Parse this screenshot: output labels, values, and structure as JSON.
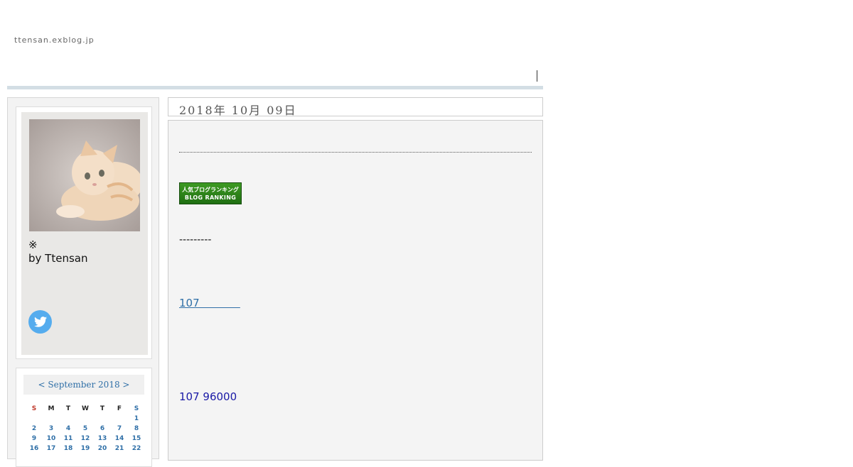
{
  "header": {
    "site_url": "ttensan.exblog.jp"
  },
  "profile": {
    "mark": "※",
    "author": "by Ttensan",
    "photo_icon": "kitten-photo",
    "twitter_icon": "twitter-bird-icon"
  },
  "calendar": {
    "prev": "<",
    "month_label": "September 2018",
    "next": ">",
    "weekdays": [
      "S",
      "M",
      "T",
      "W",
      "T",
      "F",
      "S"
    ],
    "weeks": [
      [
        "",
        "",
        "",
        "",
        "",
        "",
        "1"
      ],
      [
        "2",
        "3",
        "4",
        "5",
        "6",
        "7",
        "8"
      ],
      [
        "9",
        "10",
        "11",
        "12",
        "13",
        "14",
        "15"
      ],
      [
        "16",
        "17",
        "18",
        "19",
        "20",
        "21",
        "22"
      ]
    ]
  },
  "post": {
    "date": "2018年 10月 09日",
    "ranking_line1": "人気ブログランキング",
    "ranking_line2": "BLOG RANKING",
    "dashes": "---------",
    "link_text": "107            ",
    "price_text": "107 96000"
  },
  "colors": {
    "accent": "#2f6fa7",
    "twitter": "#55acee",
    "header_bar": "#d3dee4"
  }
}
